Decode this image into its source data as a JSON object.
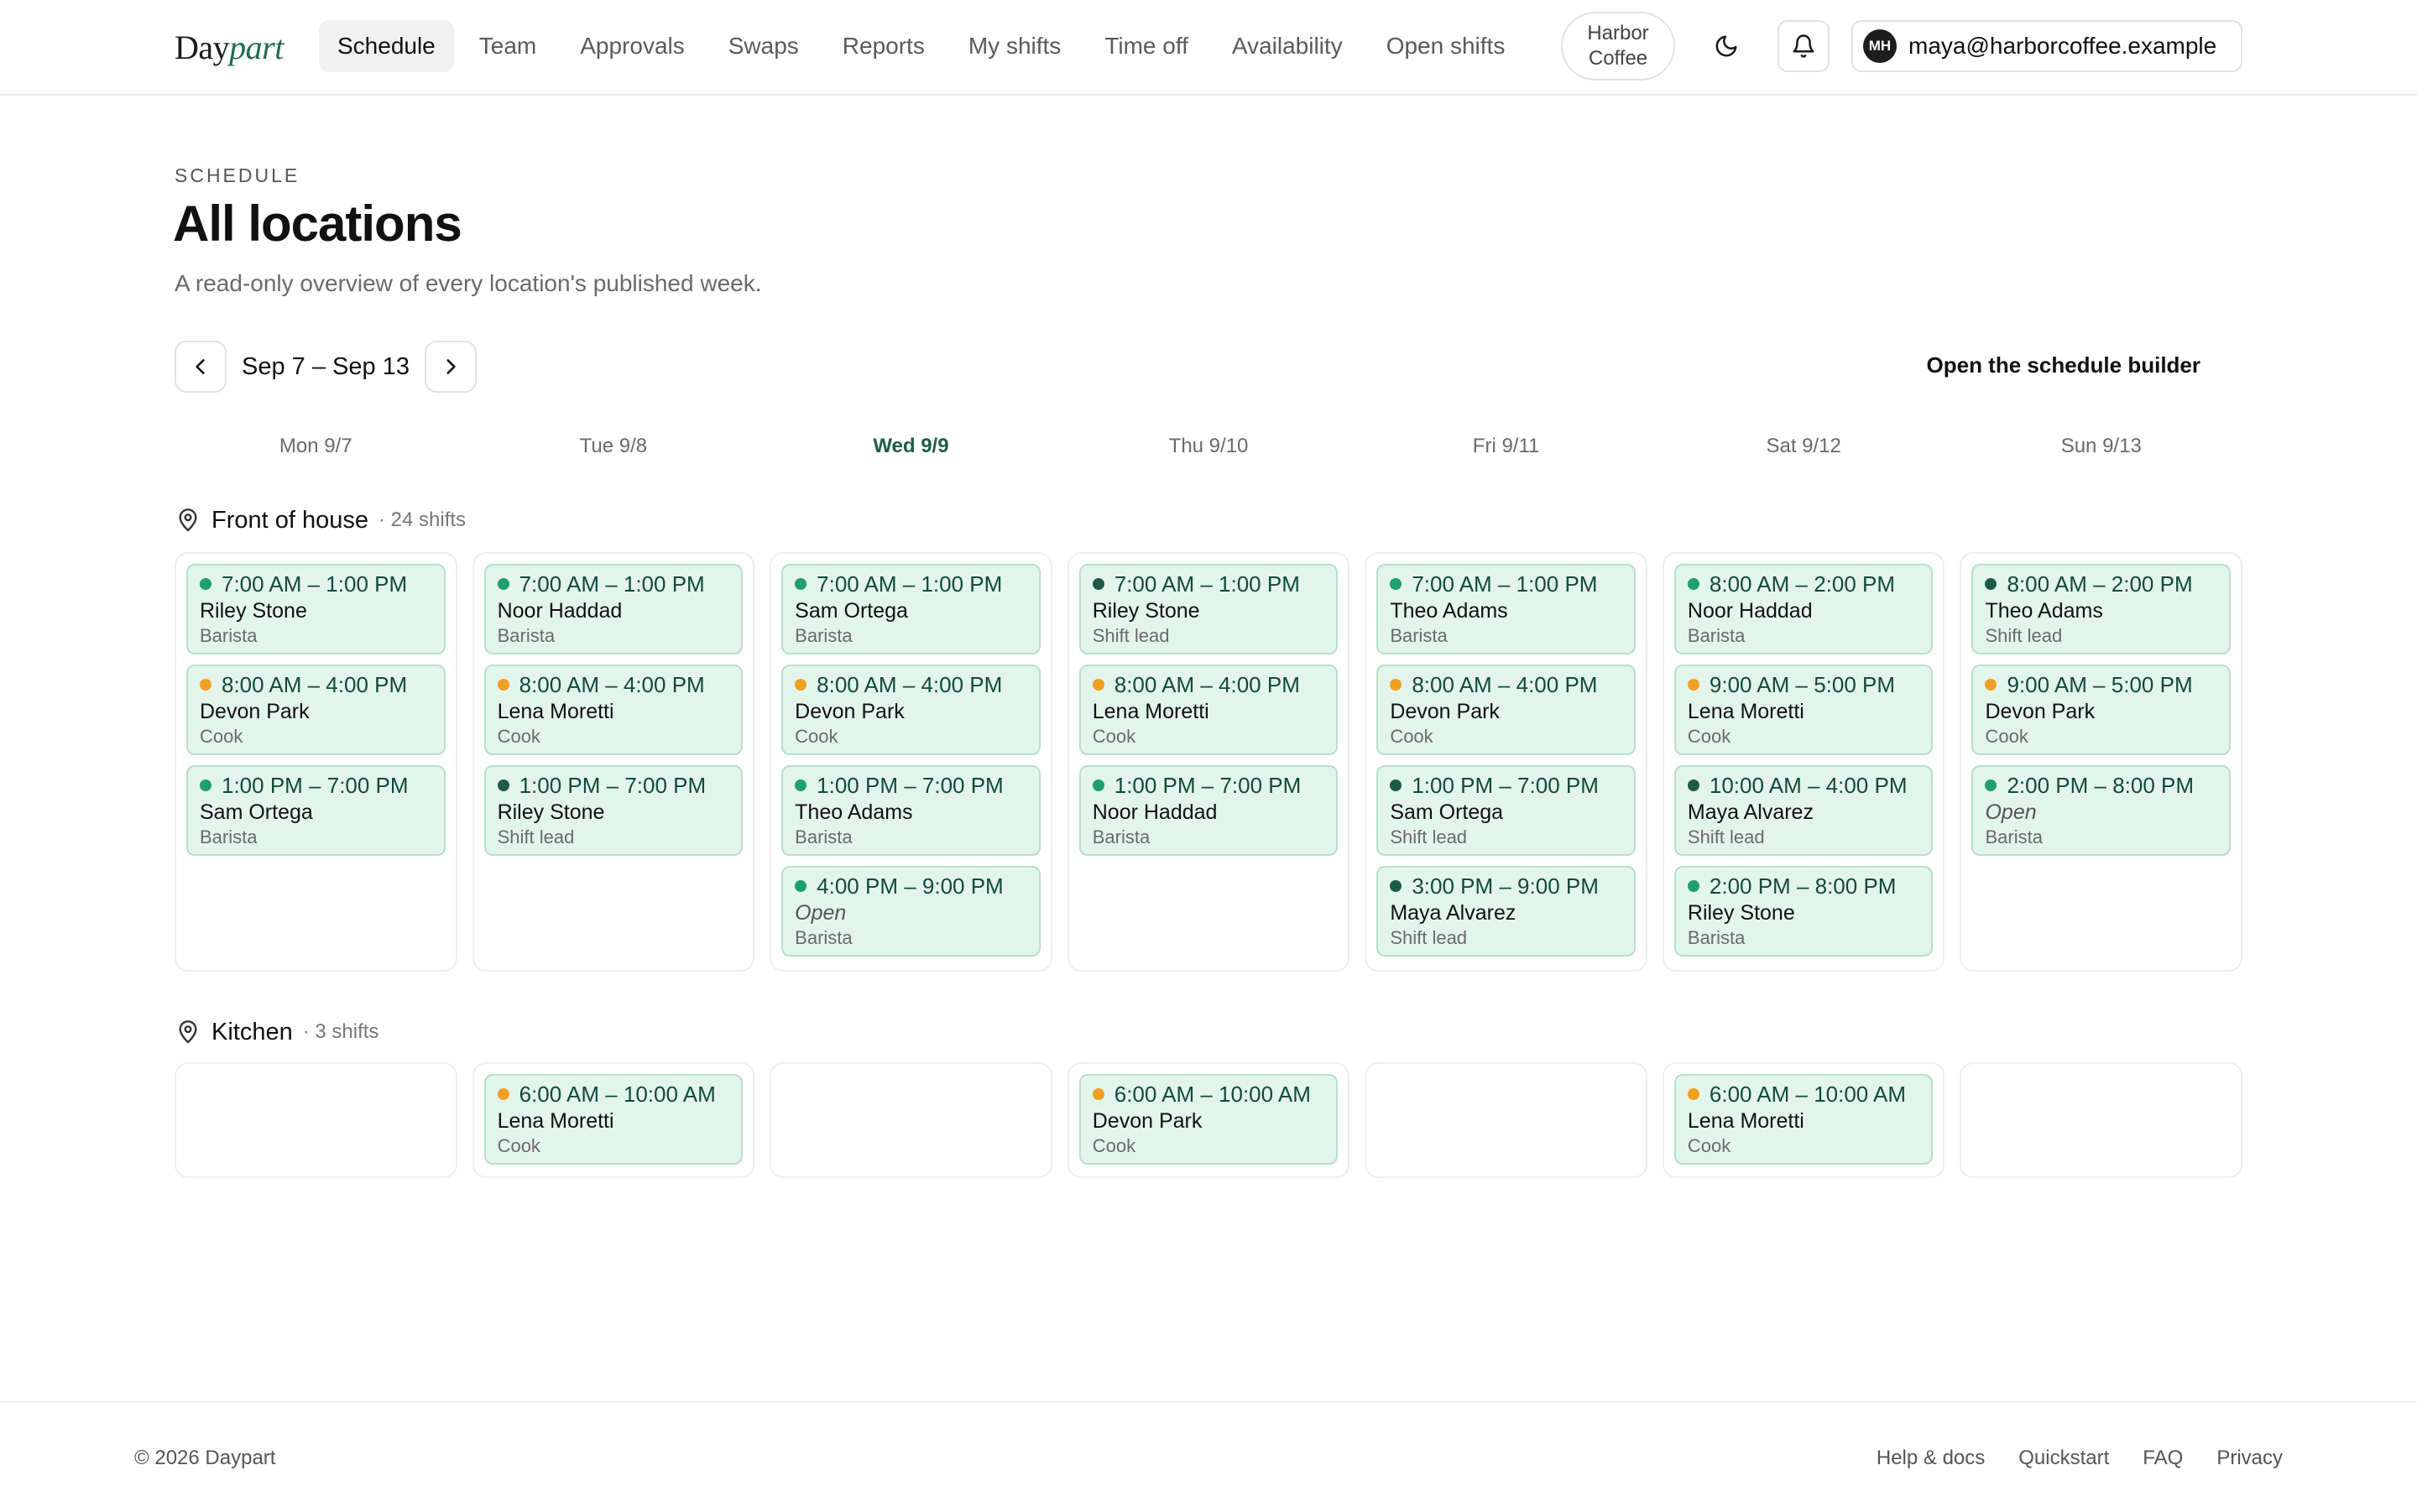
{
  "brand": {
    "part1": "Day",
    "part2": "part"
  },
  "nav": {
    "items": [
      "Schedule",
      "Team",
      "Approvals",
      "Swaps",
      "Reports",
      "My shifts",
      "Time off",
      "Availability",
      "Open shifts"
    ],
    "active": 0
  },
  "tenant": {
    "name": "Harbor Coffee"
  },
  "user": {
    "initials": "MH",
    "email": "maya@harborcoffee.example"
  },
  "page": {
    "eyebrow": "SCHEDULE",
    "title": "All locations",
    "subtitle": "A read-only overview of every location's published week."
  },
  "week": {
    "label": "Sep 7 – Sep 13",
    "builder_link": "Open the schedule builder"
  },
  "days": [
    {
      "label": "Mon 9/7",
      "today": false
    },
    {
      "label": "Tue 9/8",
      "today": false
    },
    {
      "label": "Wed 9/9",
      "today": true
    },
    {
      "label": "Thu 9/10",
      "today": false
    },
    {
      "label": "Fri 9/11",
      "today": false
    },
    {
      "label": "Sat 9/12",
      "today": false
    },
    {
      "label": "Sun 9/13",
      "today": false
    }
  ],
  "colors": {
    "barista": "#1f9e6e",
    "cook": "#f0a020",
    "lead": "#1d5a48"
  },
  "sections": [
    {
      "name": "Front of house",
      "count": "· 24 shifts",
      "columns": [
        [
          {
            "time": "7:00 AM – 1:00 PM",
            "name": "Riley Stone",
            "role": "Barista",
            "open": false
          },
          {
            "time": "8:00 AM – 4:00 PM",
            "name": "Devon Park",
            "role": "Cook",
            "open": false
          },
          {
            "time": "1:00 PM – 7:00 PM",
            "name": "Sam Ortega",
            "role": "Barista",
            "open": false
          }
        ],
        [
          {
            "time": "7:00 AM – 1:00 PM",
            "name": "Noor Haddad",
            "role": "Barista",
            "open": false
          },
          {
            "time": "8:00 AM – 4:00 PM",
            "name": "Lena Moretti",
            "role": "Cook",
            "open": false
          },
          {
            "time": "1:00 PM – 7:00 PM",
            "name": "Riley Stone",
            "role": "Shift lead",
            "open": false
          }
        ],
        [
          {
            "time": "7:00 AM – 1:00 PM",
            "name": "Sam Ortega",
            "role": "Barista",
            "open": false
          },
          {
            "time": "8:00 AM – 4:00 PM",
            "name": "Devon Park",
            "role": "Cook",
            "open": false
          },
          {
            "time": "1:00 PM – 7:00 PM",
            "name": "Theo Adams",
            "role": "Barista",
            "open": false
          },
          {
            "time": "4:00 PM – 9:00 PM",
            "name": "Open",
            "role": "Barista",
            "open": true
          }
        ],
        [
          {
            "time": "7:00 AM – 1:00 PM",
            "name": "Riley Stone",
            "role": "Shift lead",
            "open": false
          },
          {
            "time": "8:00 AM – 4:00 PM",
            "name": "Lena Moretti",
            "role": "Cook",
            "open": false
          },
          {
            "time": "1:00 PM – 7:00 PM",
            "name": "Noor Haddad",
            "role": "Barista",
            "open": false
          }
        ],
        [
          {
            "time": "7:00 AM – 1:00 PM",
            "name": "Theo Adams",
            "role": "Barista",
            "open": false
          },
          {
            "time": "8:00 AM – 4:00 PM",
            "name": "Devon Park",
            "role": "Cook",
            "open": false
          },
          {
            "time": "1:00 PM – 7:00 PM",
            "name": "Sam Ortega",
            "role": "Shift lead",
            "open": false
          },
          {
            "time": "3:00 PM – 9:00 PM",
            "name": "Maya Alvarez",
            "role": "Shift lead",
            "open": false
          }
        ],
        [
          {
            "time": "8:00 AM – 2:00 PM",
            "name": "Noor Haddad",
            "role": "Barista",
            "open": false
          },
          {
            "time": "9:00 AM – 5:00 PM",
            "name": "Lena Moretti",
            "role": "Cook",
            "open": false
          },
          {
            "time": "10:00 AM – 4:00 PM",
            "name": "Maya Alvarez",
            "role": "Shift lead",
            "open": false
          },
          {
            "time": "2:00 PM – 8:00 PM",
            "name": "Riley Stone",
            "role": "Barista",
            "open": false
          }
        ],
        [
          {
            "time": "8:00 AM – 2:00 PM",
            "name": "Theo Adams",
            "role": "Shift lead",
            "open": false
          },
          {
            "time": "9:00 AM – 5:00 PM",
            "name": "Devon Park",
            "role": "Cook",
            "open": false
          },
          {
            "time": "2:00 PM – 8:00 PM",
            "name": "Open",
            "role": "Barista",
            "open": true
          }
        ]
      ]
    },
    {
      "name": "Kitchen",
      "count": "· 3 shifts",
      "columns": [
        [],
        [
          {
            "time": "6:00 AM – 10:00 AM",
            "name": "Lena Moretti",
            "role": "Cook",
            "open": false
          }
        ],
        [],
        [
          {
            "time": "6:00 AM – 10:00 AM",
            "name": "Devon Park",
            "role": "Cook",
            "open": false
          }
        ],
        [],
        [
          {
            "time": "6:00 AM – 10:00 AM",
            "name": "Lena Moretti",
            "role": "Cook",
            "open": false
          }
        ],
        []
      ]
    }
  ],
  "footer": {
    "copyright": "© 2026 Daypart",
    "links": [
      "Help & docs",
      "Quickstart",
      "FAQ",
      "Privacy"
    ]
  }
}
